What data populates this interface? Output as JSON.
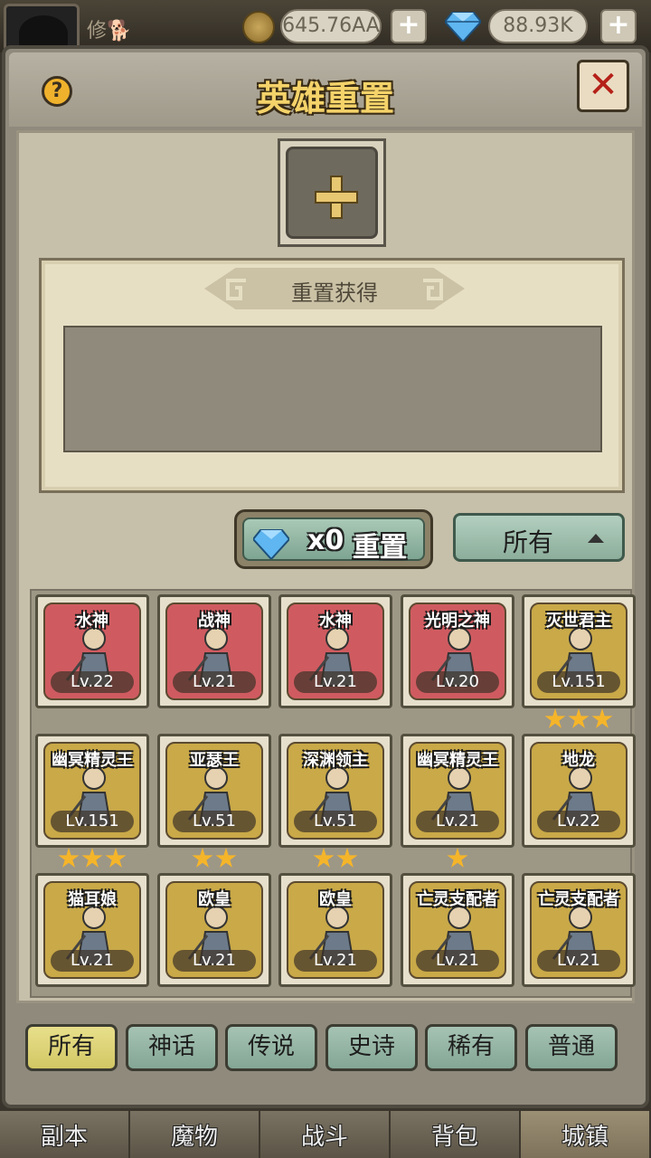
{
  "topbar": {
    "player_name": "修🐕",
    "coins": "645.76AA",
    "gems": "88.93K",
    "plus": "+"
  },
  "modal": {
    "help": "?",
    "title": "英雄重置",
    "close": "✕",
    "add_slot": "+",
    "result_label": "重置获得",
    "reset_count": "x0",
    "reset_label": "重置",
    "filter_selected": "所有"
  },
  "heroes": [
    {
      "name": "水神",
      "level": "Lv.22",
      "rarity": "mythic",
      "stars": 0
    },
    {
      "name": "战神",
      "level": "Lv.21",
      "rarity": "mythic",
      "stars": 0
    },
    {
      "name": "水神",
      "level": "Lv.21",
      "rarity": "mythic",
      "stars": 0
    },
    {
      "name": "光明之神",
      "level": "Lv.20",
      "rarity": "mythic",
      "stars": 0
    },
    {
      "name": "灭世君主",
      "level": "Lv.151",
      "rarity": "legend",
      "stars": 3
    },
    {
      "name": "幽冥精灵王",
      "level": "Lv.151",
      "rarity": "legend",
      "stars": 3
    },
    {
      "name": "亚瑟王",
      "level": "Lv.51",
      "rarity": "legend",
      "stars": 2
    },
    {
      "name": "深渊领主",
      "level": "Lv.51",
      "rarity": "legend",
      "stars": 2
    },
    {
      "name": "幽冥精灵王",
      "level": "Lv.21",
      "rarity": "legend",
      "stars": 1
    },
    {
      "name": "地龙",
      "level": "Lv.22",
      "rarity": "legend",
      "stars": 0
    },
    {
      "name": "猫耳娘",
      "level": "Lv.21",
      "rarity": "legend",
      "stars": 0
    },
    {
      "name": "欧皇",
      "level": "Lv.21",
      "rarity": "legend",
      "stars": 0
    },
    {
      "name": "欧皇",
      "level": "Lv.21",
      "rarity": "legend",
      "stars": 0
    },
    {
      "name": "亡灵支配者",
      "level": "Lv.21",
      "rarity": "legend",
      "stars": 0
    },
    {
      "name": "亡灵支配者",
      "level": "Lv.21",
      "rarity": "legend",
      "stars": 0
    }
  ],
  "rarity_tabs": [
    "所有",
    "神话",
    "传说",
    "史诗",
    "稀有",
    "普通"
  ],
  "active_tab": 0,
  "bottom_nav": [
    "副本",
    "魔物",
    "战斗",
    "背包",
    "城镇"
  ],
  "active_nav": 4,
  "colors": {
    "mythic_bg": "#cf5b60",
    "legend_bg": "#c9a948",
    "star": "#f5b52a",
    "title_gold": "#f5d36a",
    "close_red": "#b52018"
  }
}
